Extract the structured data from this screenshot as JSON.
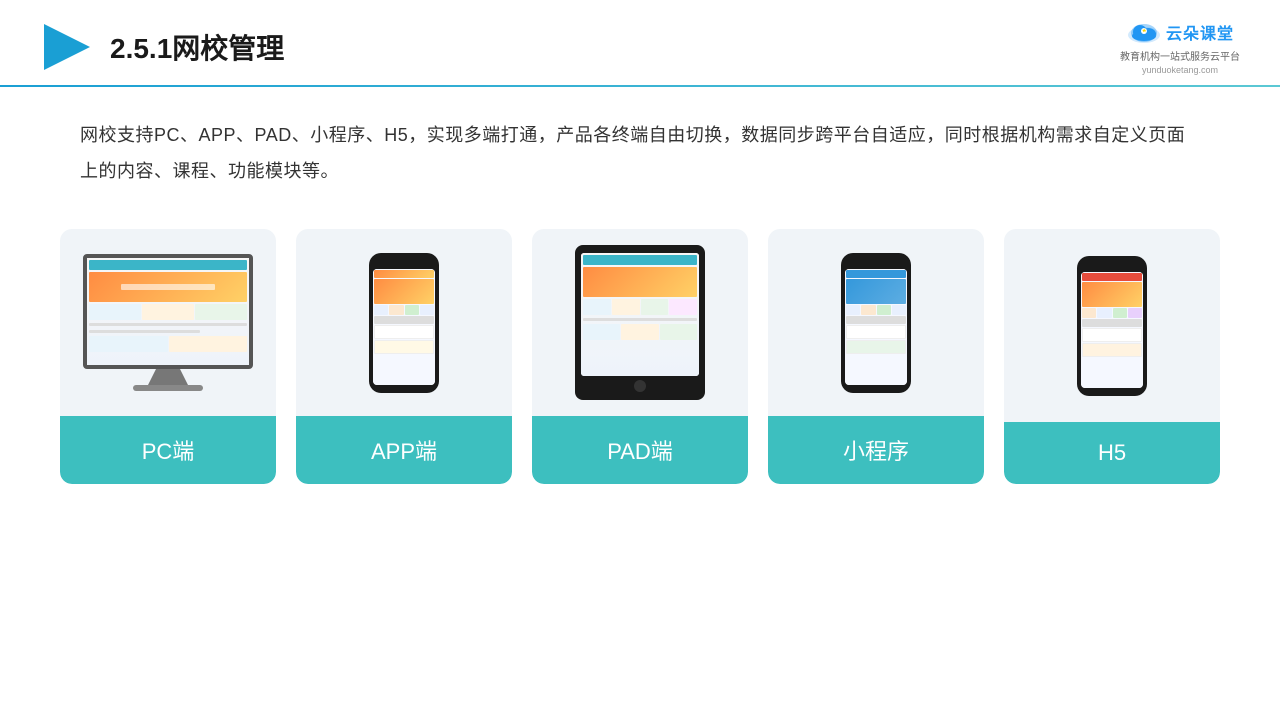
{
  "header": {
    "title_prefix": "2.5.1",
    "title_main": "网校管理",
    "brand": {
      "name": "云朵课堂",
      "url": "yunduoketang.com",
      "tagline": "教育机构一站",
      "tagline2": "式服务云平台"
    }
  },
  "description": "网校支持PC、APP、PAD、小程序、H5，实现多端打通，产品各终端自由切换，数据同步跨平台自适应，同时根据机构需求自定义页面上的内容、课程、功能模块等。",
  "cards": [
    {
      "id": "pc",
      "label": "PC端",
      "type": "monitor"
    },
    {
      "id": "app",
      "label": "APP端",
      "type": "phone"
    },
    {
      "id": "pad",
      "label": "PAD端",
      "type": "tablet"
    },
    {
      "id": "miniprogram",
      "label": "小程序",
      "type": "phone"
    },
    {
      "id": "h5",
      "label": "H5",
      "type": "phone"
    }
  ],
  "colors": {
    "accent": "#3dbfbf",
    "header_gradient_start": "#1a9fd4",
    "header_gradient_end": "#5bc8d4",
    "title_color": "#333333",
    "brand_color": "#2196F3"
  }
}
